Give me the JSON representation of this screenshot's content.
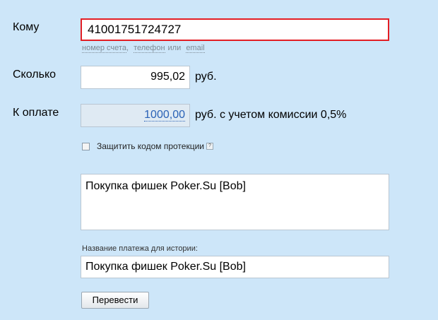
{
  "to": {
    "label": "Кому",
    "value": "41001751724727"
  },
  "hint": {
    "account": "номер счета",
    "sep": ",",
    "phone": "телефон",
    "or": "или",
    "email": "email"
  },
  "amount": {
    "label": "Сколько",
    "value": "995,02",
    "unit": "руб."
  },
  "pay": {
    "label": "К оплате",
    "value": "1000,00",
    "unit": "руб. с учетом комиссии 0,5%"
  },
  "protect": {
    "label": "Защитить кодом протекции",
    "help": "?",
    "checked": false
  },
  "comment": {
    "value": "Покупка фишек Poker.Su [Bob]"
  },
  "history": {
    "label": "Название платежа для истории:",
    "value": "Покупка фишек Poker.Su [Bob]"
  },
  "submit": {
    "label": "Перевести"
  }
}
